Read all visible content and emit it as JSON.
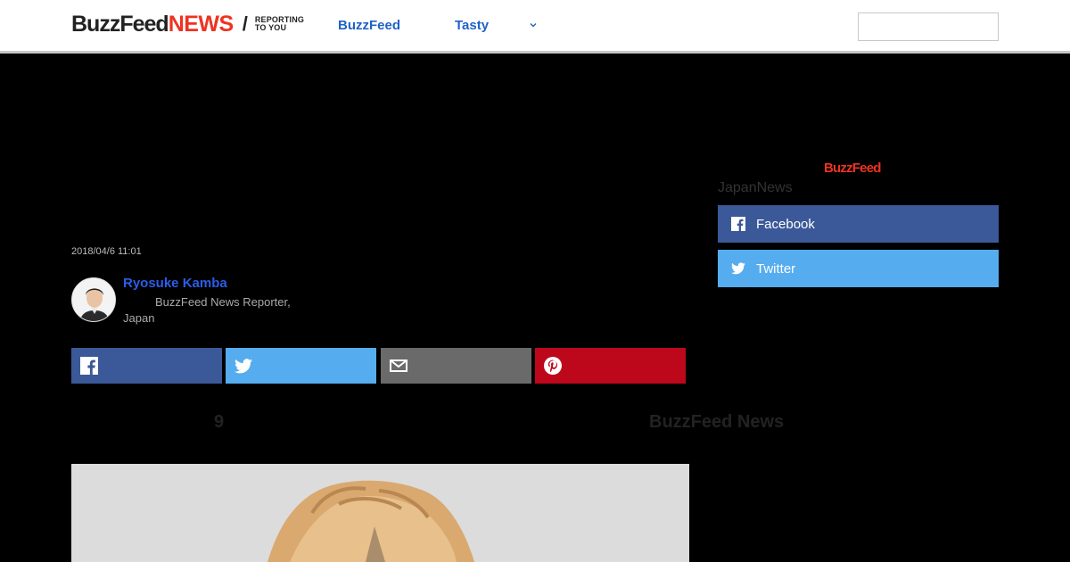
{
  "header": {
    "logo": {
      "primary": "BuzzFeed",
      "secondary": "NEWS",
      "divider": "/",
      "tagline_line1": "REPORTING",
      "tagline_line2": "TO YOU"
    },
    "nav": [
      {
        "label": "BuzzFeed"
      },
      {
        "label": "Tasty"
      }
    ],
    "more_icon": "chevron-down-icon",
    "search": {
      "placeholder": ""
    }
  },
  "sidebar": {
    "brand": "BuzzFeed",
    "label": "JapanNews",
    "buttons": [
      {
        "label": "Facebook",
        "icon": "facebook-icon",
        "color": "#3b5998"
      },
      {
        "label": "Twitter",
        "icon": "twitter-icon",
        "color": "#55acee"
      }
    ]
  },
  "article": {
    "timestamp": "2018/04/6 11:01",
    "author": {
      "name": "Ryosuke Kamba",
      "title": "BuzzFeed News Reporter, Japan",
      "avatar": "avatar-photo"
    },
    "share_buttons": [
      {
        "icon": "facebook-icon",
        "color": "#3b5998"
      },
      {
        "icon": "twitter-icon",
        "color": "#55acee"
      },
      {
        "icon": "mail-icon",
        "color": "#6a6a6a"
      },
      {
        "icon": "pinterest-icon",
        "color": "#bd081c"
      }
    ],
    "lead_number": "9",
    "lead_source": "BuzzFeed News"
  },
  "colors": {
    "accent": "#e32",
    "link": "#1f62c6",
    "author": "#2a5ee8",
    "page_bg": "#000000"
  }
}
